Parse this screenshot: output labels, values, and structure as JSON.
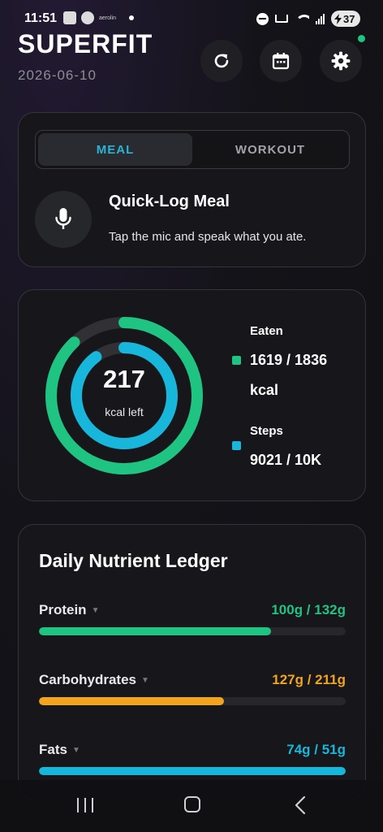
{
  "status_bar": {
    "time": "11:51",
    "tiny_label": "aerolin",
    "battery": "37"
  },
  "header": {
    "title": "SUPERFIT",
    "date": "2026-06-10",
    "icons": [
      "refresh-icon",
      "calendar-icon",
      "gear-icon"
    ]
  },
  "log": {
    "tabs": [
      {
        "label": "MEAL",
        "active": true
      },
      {
        "label": "WORKOUT",
        "active": false
      }
    ],
    "title": "Quick-Log Meal",
    "subtitle": "Tap the mic and speak what you ate."
  },
  "rings": {
    "center_value": "217",
    "center_unit": "kcal left",
    "eaten": {
      "label": "Eaten",
      "value_line1": "1619 / 1836",
      "value_line2": "kcal",
      "progress": 0.88,
      "color": "#1fc382"
    },
    "steps": {
      "label": "Steps",
      "value": "9021 / 10K",
      "progress": 0.9,
      "color": "#17b6da"
    }
  },
  "ledger": {
    "title": "Daily Nutrient Ledger",
    "items": [
      {
        "name": "Protein",
        "amount": "100g / 132g",
        "progress": 0.757,
        "color": "#1fc382"
      },
      {
        "name": "Carbohydrates",
        "amount": "127g / 211g",
        "progress": 0.602,
        "color": "#f0a41f"
      },
      {
        "name": "Fats",
        "amount": "74g / 51g",
        "progress": 1.0,
        "color": "#17b6da"
      }
    ]
  },
  "colors": {
    "accent_blue": "#2bb4d6",
    "accent_green": "#1fc382"
  }
}
